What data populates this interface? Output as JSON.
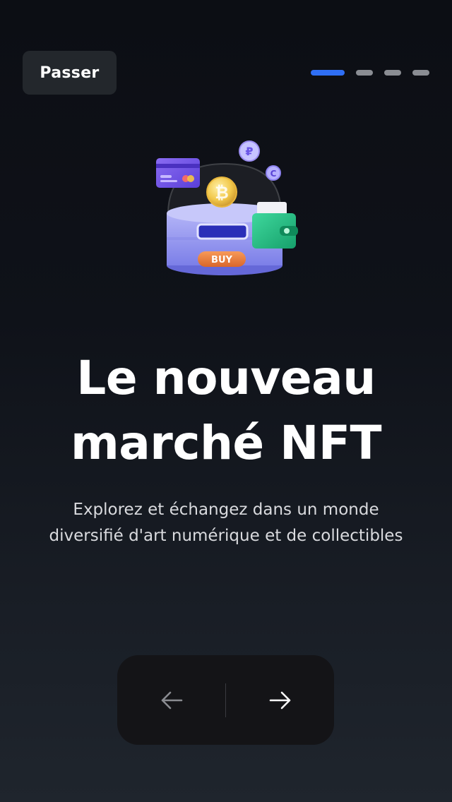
{
  "header": {
    "skip_label": "Passer",
    "pager": {
      "total": 4,
      "current": 1
    }
  },
  "hero": {
    "illustration": "nft-marketplace-illustration",
    "buy_tag": "BUY"
  },
  "content": {
    "title_line1": "Le nouveau",
    "title_line2": "marché NFT",
    "subtitle_line1": "Explorez et échangez dans un monde",
    "subtitle_line2": "diversifié d'art numérique et de collectibles"
  },
  "navigation": {
    "prev_icon": "arrow-left-icon",
    "next_icon": "arrow-right-icon"
  },
  "colors": {
    "accent": "#2f6ff5",
    "background_top": "#0c0e14",
    "background_bottom": "#1f252d",
    "button_bg": "#23272c",
    "nav_bg": "#141417"
  }
}
